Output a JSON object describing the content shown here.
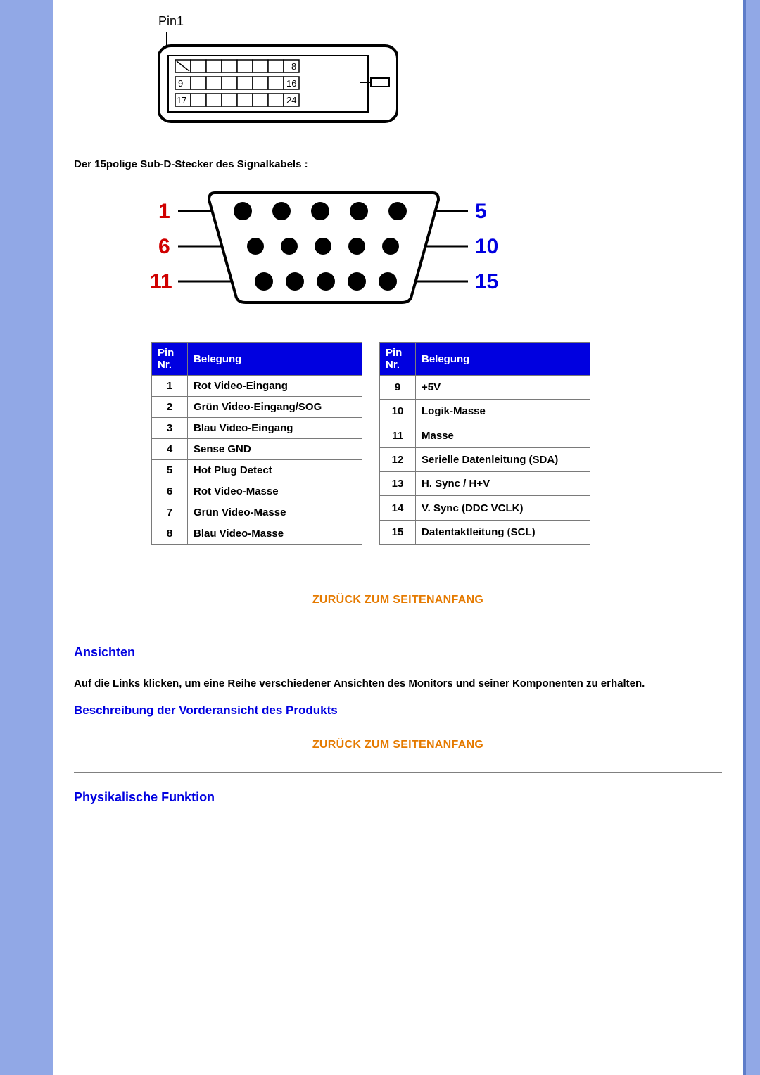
{
  "dvi": {
    "label_pin1": "Pin1",
    "row1_start": "",
    "row1_end": "8",
    "row2_start": "9",
    "row2_end": "16",
    "row3_start": "17",
    "row3_end": "24"
  },
  "subd_title": "Der 15polige Sub-D-Stecker des Signalkabels :",
  "subd_labels": {
    "r1_left": "1",
    "r1_right": "5",
    "r2_left": "6",
    "r2_right": "10",
    "r3_left": "11",
    "r3_right": "15"
  },
  "table_headers": {
    "pin_nr": "Pin Nr.",
    "belegung": "Belegung"
  },
  "table_left": [
    {
      "n": "1",
      "v": "Rot Video-Eingang"
    },
    {
      "n": "2",
      "v": "Grün Video-Eingang/SOG"
    },
    {
      "n": "3",
      "v": "Blau Video-Eingang"
    },
    {
      "n": "4",
      "v": "Sense GND"
    },
    {
      "n": "5",
      "v": "Hot Plug Detect"
    },
    {
      "n": "6",
      "v": "Rot Video-Masse"
    },
    {
      "n": "7",
      "v": "Grün Video-Masse"
    },
    {
      "n": "8",
      "v": "Blau Video-Masse"
    }
  ],
  "table_right": [
    {
      "n": "9",
      "v": "+5V"
    },
    {
      "n": "10",
      "v": "Logik-Masse"
    },
    {
      "n": "11",
      "v": "Masse"
    },
    {
      "n": "12",
      "v": "Serielle Datenleitung (SDA)"
    },
    {
      "n": "13",
      "v": "H. Sync / H+V"
    },
    {
      "n": "14",
      "v": "V. Sync (DDC VCLK)"
    },
    {
      "n": "15",
      "v": "Datentaktleitung (SCL)"
    }
  ],
  "back_to_top": "ZURÜCK ZUM SEITENANFANG",
  "sections": {
    "ansichten_heading": "Ansichten",
    "ansichten_text": "Auf die Links klicken, um eine Reihe verschiedener Ansichten des Monitors und seiner Komponenten zu erhalten.",
    "front_view_link": "Beschreibung der Vorderansicht des Produkts",
    "phys_heading": "Physikalische Funktion"
  }
}
